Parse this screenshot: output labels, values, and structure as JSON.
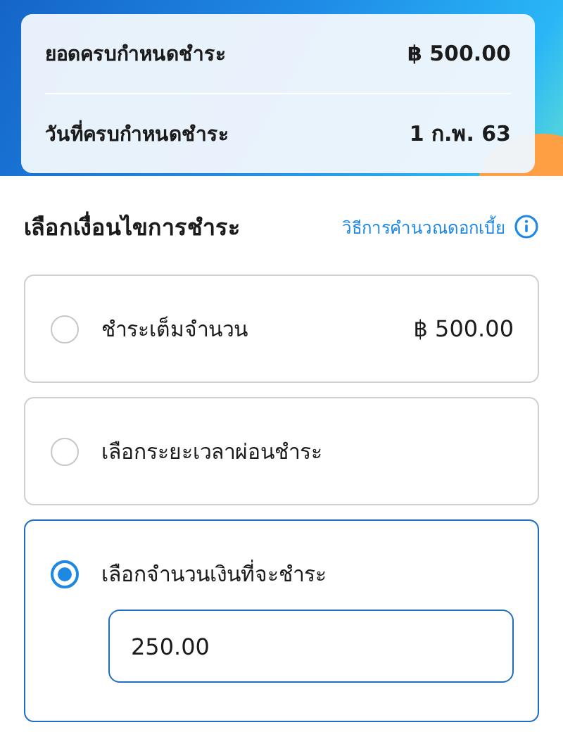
{
  "summary": [
    {
      "label": "ยอดครบกำหนดชำระ",
      "value": "฿ 500.00"
    },
    {
      "label": "วันที่ครบกำหนดชำระ",
      "value": "1 ก.พ. 63"
    }
  ],
  "section": {
    "title": "เลือกเงื่อนไขการชำระ",
    "link": "วิธีการคำนวณดอกเบี้ย"
  },
  "options": [
    {
      "label": "ชำระเต็มจำนวน",
      "amount": "฿ 500.00",
      "selected": false
    },
    {
      "label": "เลือกระยะเวลาผ่อนชำระ",
      "selected": false
    },
    {
      "label": "เลือกจำนวนเงินที่จะชำระ",
      "selected": true,
      "input": {
        "value": "250.00"
      }
    }
  ]
}
